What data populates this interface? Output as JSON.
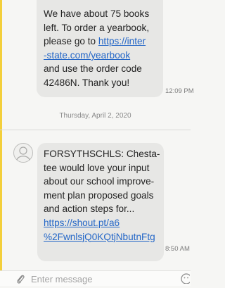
{
  "messages": [
    {
      "lines": [
        "We have about 75 books",
        "left. To order a yearbook,",
        "please go to "
      ],
      "link_parts": [
        "https://inter",
        "-state.com/yearbook"
      ],
      "after_lines": [
        "and use the order code",
        "42486N.  Thank you!"
      ],
      "time": "12:09 PM"
    },
    {
      "lines": [
        "FORSYTHSCHLS: Chesta-",
        "tee would love your input",
        "about our school improve-",
        "ment plan proposed goals",
        "and action steps for..."
      ],
      "link_parts": [
        "https://shout.pt/a6",
        "%2FwnlsjQ0KQtjNbutnFtg"
      ],
      "time": "8:50 AM"
    }
  ],
  "date_divider": "Thursday, April 2, 2020",
  "composer": {
    "placeholder": "Enter message"
  },
  "icons": {
    "attach": "paperclip-icon",
    "emoji": "emoji-icon",
    "avatar": "contact-avatar-icon"
  },
  "colors": {
    "accent_border": "#f3cf3b",
    "bubble": "#e7e7e5",
    "link": "#2366c7"
  }
}
